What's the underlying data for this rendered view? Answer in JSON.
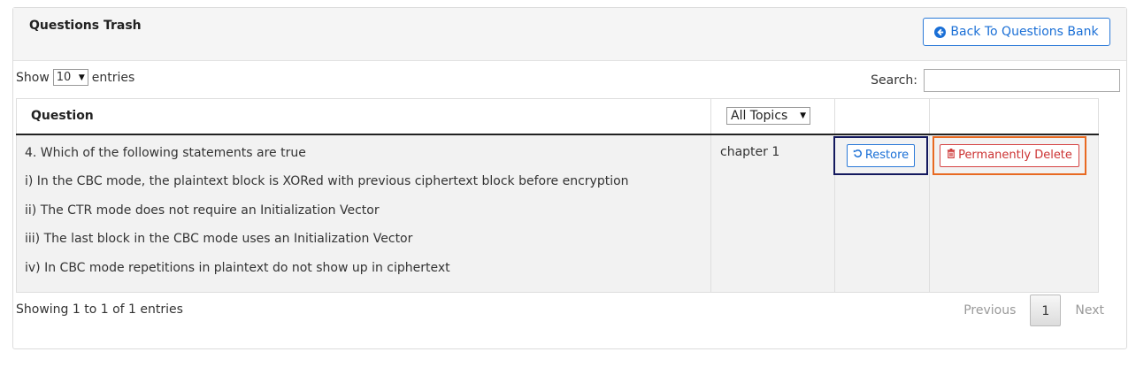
{
  "panel": {
    "title": "Questions Trash",
    "back_button": "Back To Questions Bank"
  },
  "controls": {
    "show_label": "Show",
    "page_size": "10",
    "entries_label": "entries",
    "search_label": "Search:",
    "search_value": ""
  },
  "table": {
    "columns": {
      "question": "Question",
      "topic_filter": "All Topics"
    },
    "rows": [
      {
        "question_lines": [
          "4. Which of the following statements are true",
          "i) In the CBC mode, the plaintext block is XORed with previous ciphertext block before encryption",
          "ii) The CTR mode does not require an Initialization Vector",
          "iii) The last block in the CBC mode uses an Initialization Vector",
          "iv) In CBC mode repetitions in plaintext do not show up in ciphertext"
        ],
        "topic": "chapter 1",
        "restore_label": "Restore",
        "delete_label": "Permanently Delete"
      }
    ]
  },
  "footer": {
    "info": "Showing 1 to 1 of 1 entries",
    "previous": "Previous",
    "current_page": "1",
    "next": "Next"
  },
  "icons": {
    "back": "circle-arrow-left-icon",
    "restore": "undo-icon",
    "delete": "trash-icon"
  },
  "colors": {
    "accent_blue": "#1a6fd6",
    "danger_red": "#cc3333",
    "restore_highlight": "#14195e",
    "delete_highlight": "#e86a22"
  }
}
